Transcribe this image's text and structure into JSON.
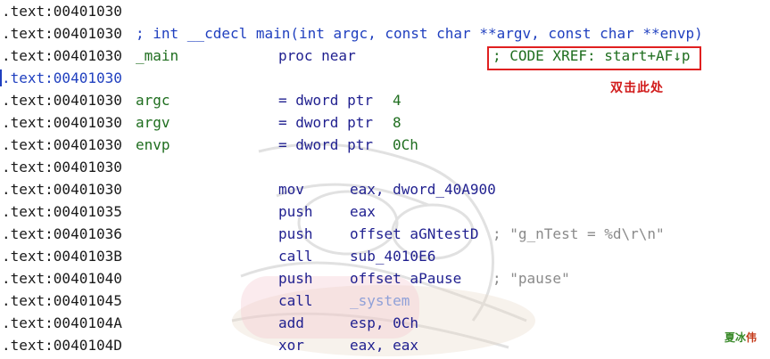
{
  "listing": [
    {
      "addr": ".text:00401030",
      "selected": false
    },
    {
      "addr": ".text:00401030",
      "selected": false,
      "comment": "; int __cdecl main(int argc, const char **argv, const char **envp)"
    },
    {
      "addr": ".text:00401030",
      "selected": false,
      "label": "_main",
      "mnemonic": "proc near",
      "xref": "; CODE XREF: start+AF↓p"
    },
    {
      "addr": ".text:00401030",
      "selected": true
    },
    {
      "addr": ".text:00401030",
      "selected": false,
      "label": "argc",
      "mnemonic": "= dword ptr",
      "operand": "4"
    },
    {
      "addr": ".text:00401030",
      "selected": false,
      "label": "argv",
      "mnemonic": "= dword ptr",
      "operand": "8"
    },
    {
      "addr": ".text:00401030",
      "selected": false,
      "label": "envp",
      "mnemonic": "= dword ptr",
      "operand": "0Ch"
    },
    {
      "addr": ".text:00401030",
      "selected": false
    },
    {
      "addr": ".text:00401030",
      "selected": false,
      "mnemonic": "mov",
      "operand": "eax, dword_40A900"
    },
    {
      "addr": ".text:00401035",
      "selected": false,
      "mnemonic": "push",
      "operand": "eax"
    },
    {
      "addr": ".text:00401036",
      "selected": false,
      "mnemonic": "push",
      "operand": "offset aGNtestD",
      "comment": "; \"g_nTest = %d\\r\\n\""
    },
    {
      "addr": ".text:0040103B",
      "selected": false,
      "mnemonic": "call",
      "operand": "sub_4010E6"
    },
    {
      "addr": ".text:00401040",
      "selected": false,
      "mnemonic": "push",
      "operand": "offset aPause",
      "comment": "; \"pause\""
    },
    {
      "addr": ".text:00401045",
      "selected": false,
      "mnemonic": "call",
      "operand": "_system",
      "operand_style": "import"
    },
    {
      "addr": ".text:0040104A",
      "selected": false,
      "mnemonic": "add",
      "operand": "esp, 0Ch"
    },
    {
      "addr": ".text:0040104D",
      "selected": false,
      "mnemonic": "xor",
      "operand": "eax, eax"
    }
  ],
  "annotation": "双击此处",
  "watermark": "夏冰伟",
  "colors": {
    "address": "#1a1a1a",
    "selected_address": "#1f3fbf",
    "comment": "#1f3fbf",
    "label": "#1f6e1f",
    "mnemonic": "#1f1f8f",
    "string_comment": "#8a8a8a",
    "highlight_box": "#e02020",
    "annotation": "#d11a1a"
  }
}
